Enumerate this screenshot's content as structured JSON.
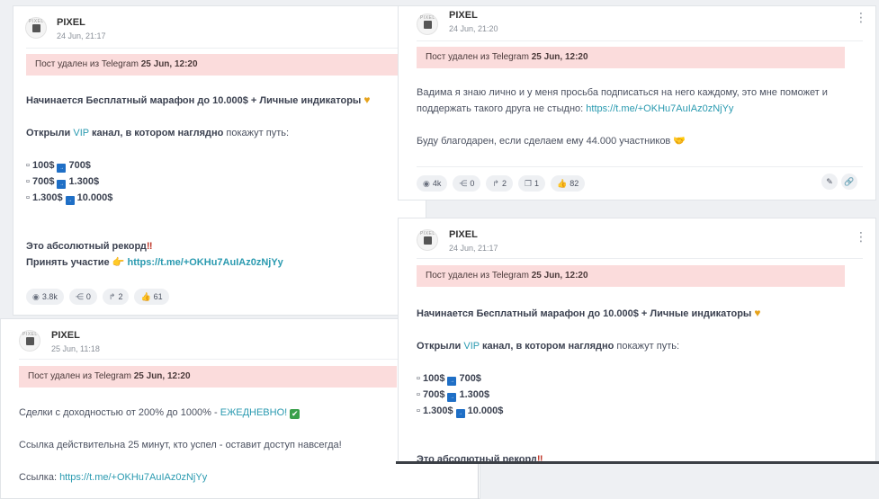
{
  "posts": [
    {
      "channel": "PIXEL",
      "date": "24 Jun, 21:17",
      "deleted_prefix": "Пост удален из Telegram",
      "deleted_date": "25 Jun, 12:20",
      "line1": "Начинается Бесплатный марафон до 10.000$ + Личные индикаторы",
      "line2_a": "Открыли",
      "line2_vip": "VIP",
      "line2_b": "канал, в котором наглядно",
      "line2_c": "покажут путь:",
      "steps": [
        {
          "from": "100$",
          "to": "700$"
        },
        {
          "from": "700$",
          "to": "1.300$"
        },
        {
          "from": "1.300$",
          "to": "10.000$"
        }
      ],
      "record": "Это абсолютный рекорд",
      "join_label": "Принять участие",
      "join_link": "https://t.me/+OKHu7AuIAz0zNjYy",
      "stats": {
        "views": "3.8k",
        "shares": "0",
        "reposts": "2",
        "likes": "61"
      }
    },
    {
      "channel": "PIXEL",
      "date": "24 Jun, 21:20",
      "deleted_prefix": "Пост удален из Telegram",
      "deleted_date": "25 Jun, 12:20",
      "text1": "Вадима я знаю лично и у меня просьба подписаться на него каждому, это мне поможет и",
      "text2": "поддержать такого друга не стыдно:",
      "link": "https://t.me/+OKHu7AuIAz0zNjYy",
      "text3": "Буду благодарен, если сделаем ему 44.000 участников 🤝",
      "stats": {
        "views": "4k",
        "shares": "0",
        "reposts": "2",
        "comments": "1",
        "likes": "82"
      }
    },
    {
      "channel": "PIXEL",
      "date": "24 Jun, 21:17",
      "deleted_prefix": "Пост удален из Telegram",
      "deleted_date": "25 Jun, 12:20",
      "line1": "Начинается Бесплатный марафон до 10.000$ + Личные индикаторы",
      "line2_a": "Открыли",
      "line2_vip": "VIP",
      "line2_b": "канал, в котором наглядно",
      "line2_c": "покажут путь:",
      "steps": [
        {
          "from": "100$",
          "to": "700$"
        },
        {
          "from": "700$",
          "to": "1.300$"
        },
        {
          "from": "1.300$",
          "to": "10.000$"
        }
      ],
      "record": "Это абсолютный рекорд"
    },
    {
      "channel": "PIXEL",
      "date": "25 Jun, 11:18",
      "deleted_prefix": "Пост удален из Telegram",
      "deleted_date": "25 Jun, 12:20",
      "text1_a": "Сделки с доходностью от 200% до 1000% -",
      "text1_b": "ЕЖЕДНЕВНО!",
      "text2": "Ссылка действительна 25 минут, кто успел - оставит доступ навсегда!",
      "text3_label": "Ссылка:",
      "link": "https://t.me/+OKHu7AuIAz0zNjYy"
    }
  ],
  "icons": {
    "views": "eye-icon",
    "shares": "share-icon",
    "reposts": "repost-icon",
    "comments": "comment-icon",
    "likes": "thumbs-up-icon",
    "edit": "pencil-icon",
    "link": "link-icon",
    "menu": "more-vertical-icon"
  },
  "colors": {
    "banner": "#fbdcdc",
    "link": "#2a9ab0",
    "accent_vip": "#2a9ab0"
  }
}
